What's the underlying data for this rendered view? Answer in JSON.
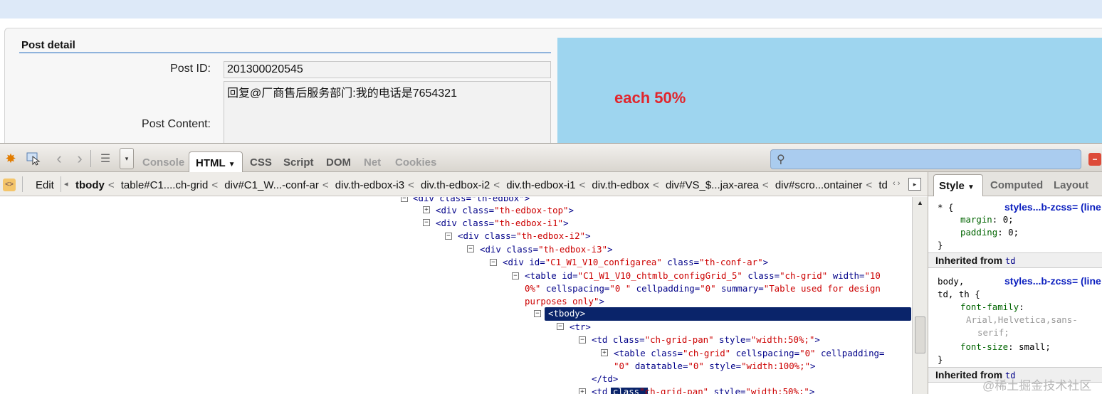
{
  "page": {
    "section_title": "Post detail",
    "post_id_label": "Post ID:",
    "post_id_value": "201300020545",
    "post_content_label": "Post Content:",
    "post_content_value": "回复@厂商售后服务部门:我的电话是7654321",
    "blue_box_text": "each 50%"
  },
  "firebug": {
    "tabs": [
      {
        "label": "Console",
        "state": "disabled"
      },
      {
        "label": "HTML",
        "state": "active"
      },
      {
        "label": "CSS",
        "state": "normal"
      },
      {
        "label": "Script",
        "state": "normal"
      },
      {
        "label": "DOM",
        "state": "normal"
      },
      {
        "label": "Net",
        "state": "disabled"
      },
      {
        "label": "Cookies",
        "state": "disabled"
      }
    ],
    "html_tab_label": "HTML",
    "html_tab_arrow": "▼",
    "search_placeholder": "",
    "edit_label": "Edit",
    "breadcrumbs": [
      "tbody",
      "table#C1....ch-grid",
      "div#C1_W...-conf-ar",
      "div.th-edbox-i3",
      "div.th-edbox-i2",
      "div.th-edbox-i1",
      "div.th-edbox",
      "div#VS_$...jax-area",
      "div#scro...ontainer",
      "td"
    ]
  },
  "tree": {
    "line0": "<div class=\"th-edbox\">",
    "line1_tag": "<div ",
    "line1_attr": "class=",
    "line1_val": "\"th-edbox-top\"",
    "line1_end": ">",
    "line2_tag": "<div ",
    "line2_attr": "class=",
    "line2_val": "\"th-edbox-i1\"",
    "line2_end": ">",
    "line3_tag": "<div ",
    "line3_attr": "class=",
    "line3_val": "\"th-edbox-i2\"",
    "line3_end": ">",
    "line4_tag": "<div ",
    "line4_attr": "class=",
    "line4_val": "\"th-edbox-i3\"",
    "line4_end": ">",
    "line5_tag": "<div ",
    "line5_attr": "id=",
    "line5_val": "\"C1_W1_V10_configarea\"",
    "line5_attr2": " class=",
    "line5_val2": "\"th-conf-ar\"",
    "line5_end": ">",
    "line6_tag": "<table ",
    "line6_attr": "id=",
    "line6_val": "\"C1_W1_V10_chtmlb_configGrid_5\"",
    "line6_attr2": " class=",
    "line6_val2": "\"ch-grid\"",
    "line6_attr3": " width=",
    "line6_val3": "\"10",
    "line7_val": "0%\"",
    "line7_attr": " cellspacing=",
    "line7_val2": "\"0 \"",
    "line7_attr2": " cellpadding=",
    "line7_val3": "\"0\"",
    "line7_attr3": " summary=",
    "line7_val4": "\"Table used for design",
    "line8_val": "purposes only\"",
    "line8_end": ">",
    "selected": "<tbody>",
    "line10": "<tr>",
    "line11_tag": "<td ",
    "line11_attr": "class=",
    "line11_val": "\"ch-grid-pan\"",
    "line11_attr2": " style=",
    "line11_val2": "\"width:50%;\"",
    "line11_end": ">",
    "line12_tag": "<table ",
    "line12_attr": "class=",
    "line12_val": "\"ch-grid\"",
    "line12_attr2": " cellspacing=",
    "line12_val2": "\"0\"",
    "line12_attr3": " cellpadding=",
    "line13_val": "\"0\"",
    "line13_attr": " datatable=",
    "line13_val2": "\"0\"",
    "line13_attr2": " style=",
    "line13_val3": "\"width:100%;\"",
    "line13_end": ">",
    "line14": "</td>",
    "line15_tag": "<td ",
    "line15_attr": "class",
    "line15_val": "\"ch-grid-pan\"",
    "line15_attr2": " style=",
    "line15_val2": "\"width:50%;\"",
    "line15_end": ">"
  },
  "side": {
    "tabs": [
      "Style",
      "Computed",
      "Layout"
    ],
    "style_arrow": "▼",
    "rule1_selector": "* {",
    "rule1_source": "styles...b-zcss= (line",
    "rule1_prop1": "margin",
    "rule1_val1": "0;",
    "rule1_prop2": "padding",
    "rule1_val2": "0;",
    "rule1_close": "}",
    "inherited_label": "Inherited from",
    "inherited_tag": "td",
    "rule2_sel1": "body,",
    "rule2_sel2": "td, th {",
    "rule2_source": "styles...b-zcss= (line",
    "rule2_prop1": "font-family",
    "rule2_val1a": "Arial,Helvetica,sans-",
    "rule2_val1b": "serif;",
    "rule2_prop2": "font-size",
    "rule2_val2": "small;",
    "rule2_close": "}",
    "inherited2_label": "Inherited from",
    "inherited2_tag": "td"
  },
  "watermark": "@稀土掘金技术社区"
}
